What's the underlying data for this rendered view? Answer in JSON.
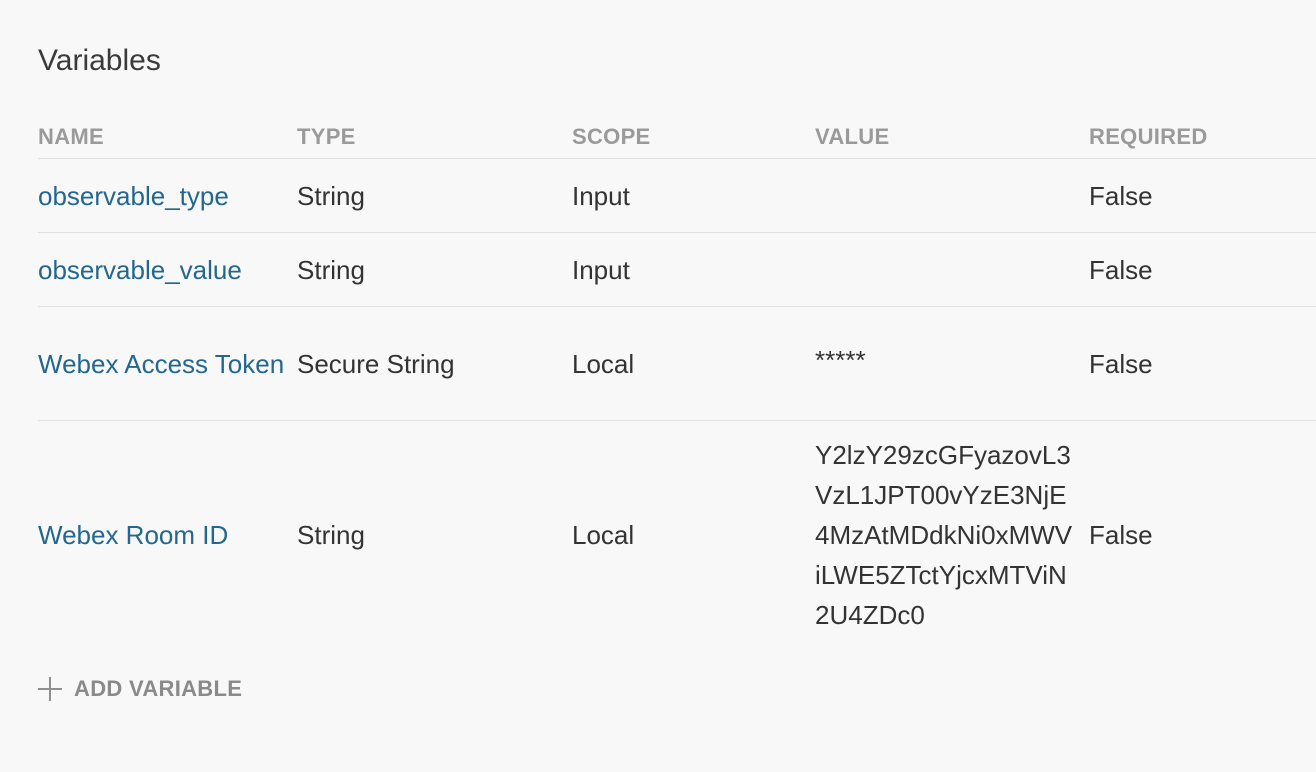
{
  "section": {
    "title": "Variables"
  },
  "table": {
    "headers": {
      "name": "NAME",
      "type": "TYPE",
      "scope": "SCOPE",
      "value": "VALUE",
      "required": "REQUIRED"
    },
    "rows": [
      {
        "name": "observable_type",
        "type": "String",
        "scope": "Input",
        "value": "",
        "required": "False"
      },
      {
        "name": "observable_value",
        "type": "String",
        "scope": "Input",
        "value": "",
        "required": "False"
      },
      {
        "name": "Webex Access Token",
        "type": "Secure String",
        "scope": "Local",
        "value": "*****",
        "required": "False"
      },
      {
        "name": "Webex Room ID",
        "type": "String",
        "scope": "Local",
        "value": "Y2lzY29zcGFyazovL3VzL1JPT00vYzE3NjE4MzAtMDdkNi0xMWViLWE5ZTctYjcxMTViN2U4ZDc0",
        "required": "False"
      }
    ]
  },
  "actions": {
    "add_variable_label": "ADD VARIABLE",
    "add_icon": "plus-icon"
  },
  "colors": {
    "link": "#23678f",
    "header_text": "#9a9a9a",
    "background": "#f8f8f8",
    "divider": "#e1e1e1"
  }
}
